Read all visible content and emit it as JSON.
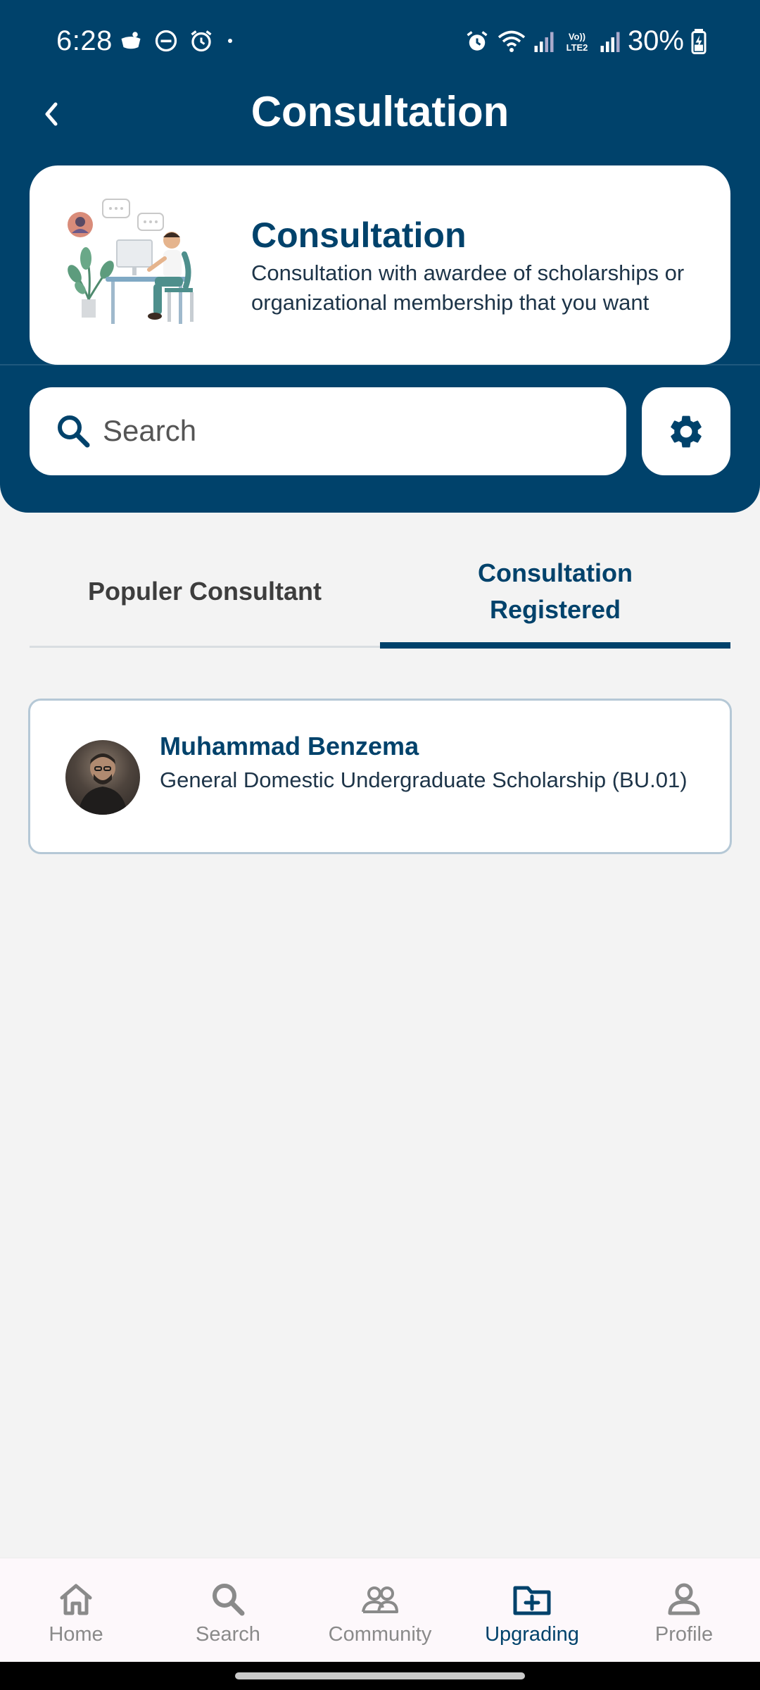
{
  "status_bar": {
    "time": "6:28",
    "battery": "30%",
    "network_label": "Vo)) LTE2"
  },
  "header": {
    "title": "Consultation"
  },
  "banner": {
    "title": "Consultation",
    "description": "Consultation with awardee of scholarships or organizational membership that you want"
  },
  "search": {
    "placeholder": "Search"
  },
  "tabs": [
    {
      "label": "Populer Consultant",
      "active": false
    },
    {
      "label": "Consultation Registered",
      "active": true
    }
  ],
  "consultations": [
    {
      "name": "Muhammad Benzema",
      "program": "General Domestic Undergraduate  Scholarship (BU.01)"
    }
  ],
  "bottom_nav": [
    {
      "label": "Home",
      "icon": "home-icon",
      "active": false
    },
    {
      "label": "Search",
      "icon": "search-icon",
      "active": false
    },
    {
      "label": "Community",
      "icon": "community-icon",
      "active": false
    },
    {
      "label": "Upgrading",
      "icon": "folder-plus-icon",
      "active": true
    },
    {
      "label": "Profile",
      "icon": "profile-icon",
      "active": false
    }
  ],
  "colors": {
    "primary": "#00426b",
    "background": "#f3f3f3",
    "inactive": "#8a8a8a"
  }
}
